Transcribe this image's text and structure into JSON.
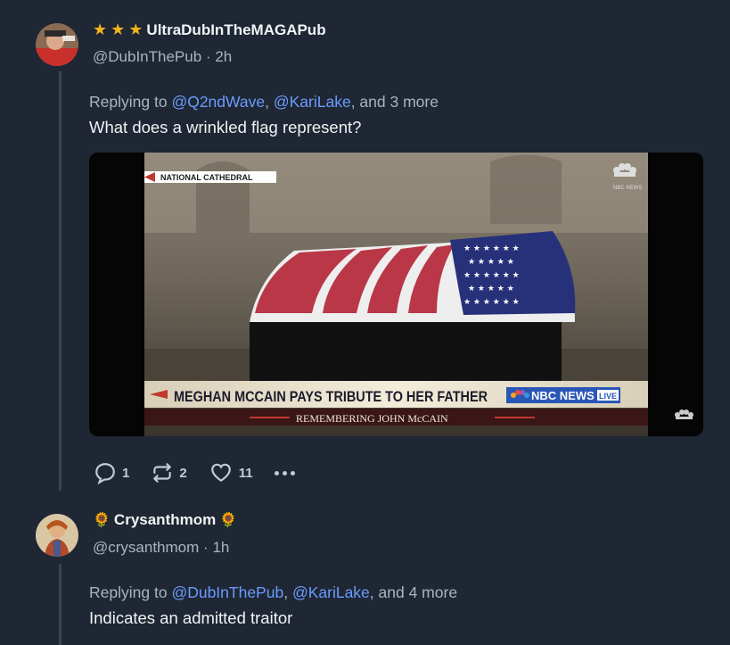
{
  "posts": [
    {
      "display_name": "UltraDubInTheMAGAPub",
      "handle": "@DubInThePub",
      "separator": "·",
      "time": "2h",
      "replying_prefix": "Replying to",
      "mention1": "@Q2ndWave",
      "mention2": "@KariLake",
      "and_more": ", and 3 more",
      "text": "What does a wrinkled flag represent?",
      "stats": {
        "replies": "1",
        "reposts": "2",
        "likes": "11"
      }
    },
    {
      "display_name": "Crysanthmom",
      "handle": "@crysanthmom",
      "separator": "·",
      "time": "1h",
      "replying_prefix": "Replying to",
      "mention1": "@DubInThePub",
      "mention2": "@KariLake",
      "and_more": ", and 4 more",
      "text": "Indicates an admitted traitor"
    }
  ],
  "media": {
    "location_tag": "NATIONAL CATHEDRAL",
    "network_logo": "NBC NEWS",
    "headline": "MEGHAN MCCAIN PAYS TRIBUTE TO HER FATHER",
    "network": "NBC NEWS",
    "live": "LIVE",
    "subline": "REMEMBERING JOHN McCAIN"
  },
  "icons": {
    "star": "star-icon",
    "flower": "sunflower-icon",
    "reply": "comment-icon",
    "repost": "repost-icon",
    "like": "heart-icon",
    "more": "more-dots-icon"
  },
  "colors": {
    "background": "#1e2733",
    "link": "#6c9bff",
    "star": "#f2b21d"
  }
}
